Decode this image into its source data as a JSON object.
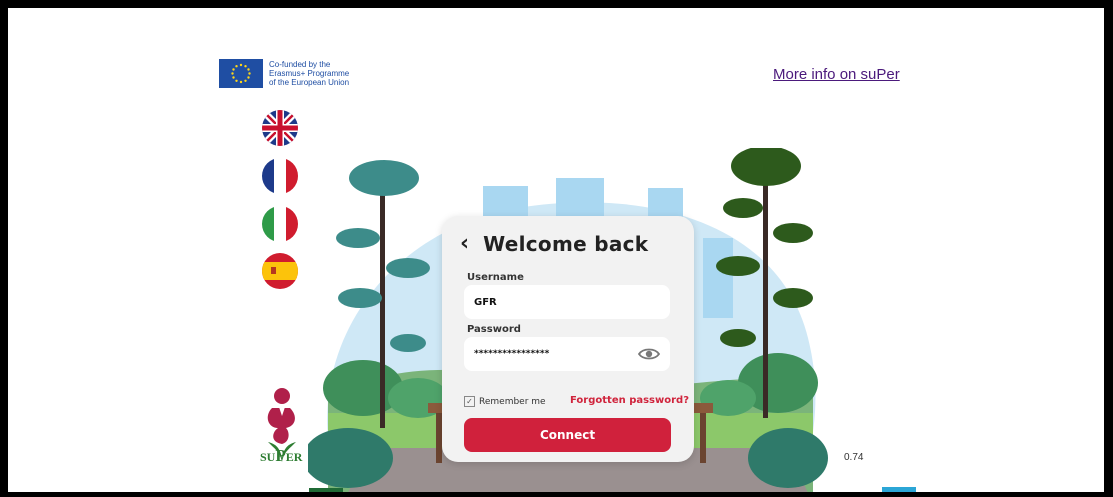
{
  "header": {
    "eu_text_line1": "Co-funded by the",
    "eu_text_line2": "Erasmus+ Programme",
    "eu_text_line3": "of the European Union",
    "more_info_link": "More info on suPer"
  },
  "languages": [
    {
      "name": "english",
      "icon": "uk-flag-icon"
    },
    {
      "name": "french",
      "icon": "france-flag-icon"
    },
    {
      "name": "italian",
      "icon": "italy-flag-icon"
    },
    {
      "name": "spanish",
      "icon": "spain-flag-icon"
    }
  ],
  "login": {
    "back_icon": "chevron-left-icon",
    "title": "Welcome back",
    "username_label": "Username",
    "username_value": "GFR",
    "password_label": "Password",
    "password_value": "****************",
    "eye_icon": "eye-icon",
    "remember_label": "Remember me",
    "remember_checked": true,
    "forgot_link": "Forgotten password?",
    "connect_button": "Connect"
  },
  "logo": {
    "text_small_s": "SU",
    "text_big_p": "P",
    "text_er": "ER"
  },
  "version": "0.74",
  "colors": {
    "accent": "#d0213c",
    "link": "#4b1a7c",
    "eu_blue": "#1f4ea3"
  }
}
